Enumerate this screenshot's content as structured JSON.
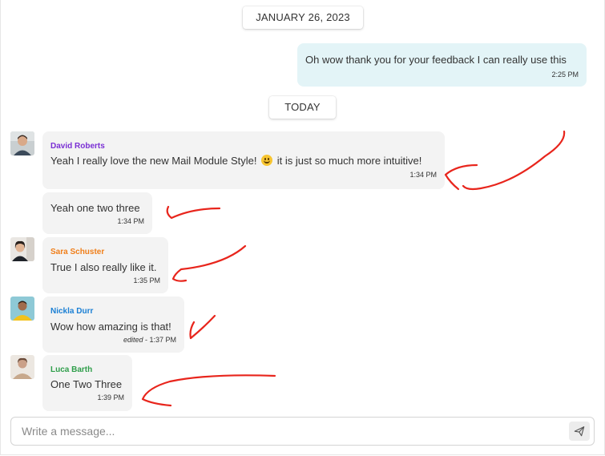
{
  "chat": {
    "date_separator": "JANUARY 26, 2023",
    "today_separator": "TODAY",
    "own_message": {
      "text": "Oh wow thank you for your feedback I can really use this",
      "time": "2:25 PM"
    },
    "messages": [
      {
        "sender": "David Roberts",
        "sender_color": "#7a2fd4",
        "text_before": "Yeah I really love the new Mail Module Style!",
        "emoji": "grinning-face-emoji",
        "text_after": "it is just so much more intuitive!",
        "time": "1:34 PM"
      },
      {
        "text": "Yeah one two three",
        "time": "1:34 PM"
      },
      {
        "sender": "Sara Schuster",
        "sender_color": "#f07f1a",
        "text": "True I also really like it.",
        "time": "1:35 PM"
      },
      {
        "sender": "Nickla Durr",
        "sender_color": "#1a7fd4",
        "text": "Wow how amazing is that!",
        "edited_label": "edited",
        "time": "- 1:37 PM"
      },
      {
        "sender": "Luca Barth",
        "sender_color": "#2e9e4a",
        "text": "One Two Three",
        "time": "1:39 PM"
      }
    ]
  },
  "composer": {
    "placeholder": "Write a message...",
    "send_icon": "send-icon"
  },
  "colors": {
    "annotation_red": "#e8251c",
    "own_bubble": "#e3f4f7",
    "other_bubble": "#f3f3f3"
  }
}
